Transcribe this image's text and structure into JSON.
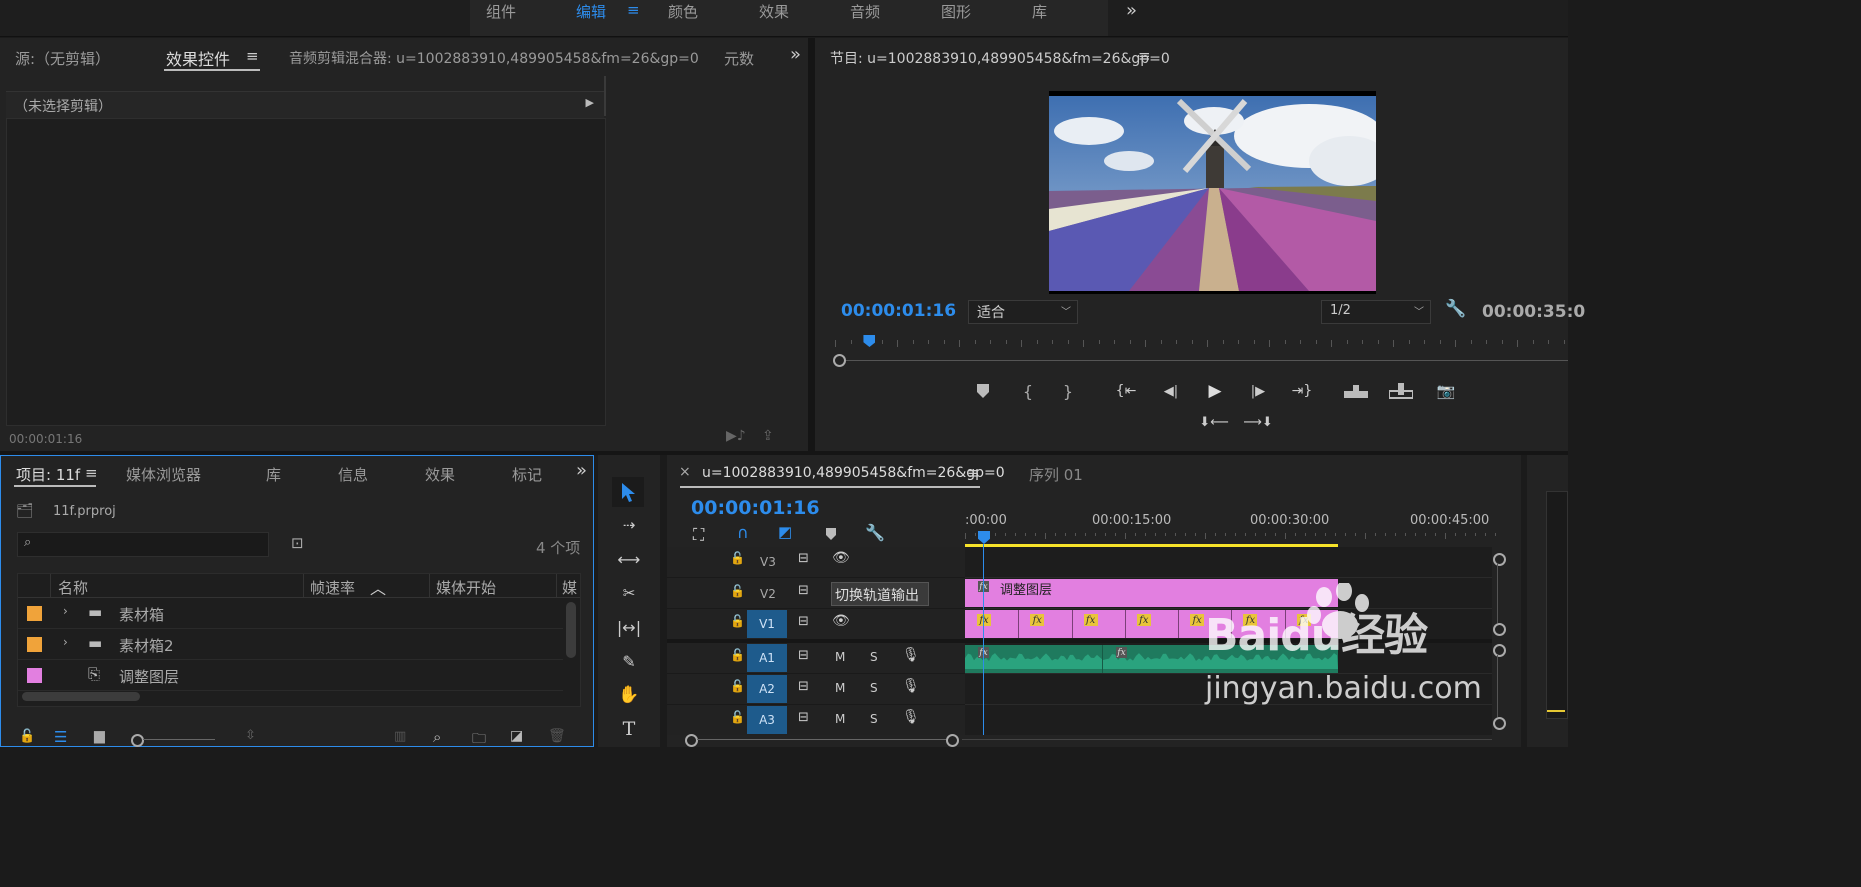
{
  "workspace_tabs": {
    "items": [
      "组件",
      "编辑",
      "颜色",
      "效果",
      "音频",
      "图形",
      "库"
    ],
    "active": "编辑",
    "more": "»"
  },
  "source_panel": {
    "tabs": [
      "源:（无剪辑）",
      "效果控件",
      "音频剪辑混合器: u=1002883910,489905458&fm=26&gp=0",
      "元数"
    ],
    "active_tab": "效果控件",
    "no_clip_label": "（未选择剪辑）",
    "timecode": "00:00:01:16",
    "more": "»"
  },
  "program_monitor": {
    "title": "节目: u=1002883910,489905458&fm=26&gp=0",
    "timecode": "00:00:01:16",
    "fit_label": "适合",
    "resolution": "1/2",
    "duration": "00:00:35:0",
    "playhead_fraction": 0.047
  },
  "project_panel": {
    "tabs": [
      "项目: 11f",
      "媒体浏览器",
      "库",
      "信息",
      "效果",
      "标记"
    ],
    "active_tab": "项目: 11f",
    "project_file": "11f.prproj",
    "search_placeholder": "",
    "item_count": "4 个项",
    "columns": [
      "名称",
      "帧速率",
      "媒体开始",
      "媒"
    ],
    "rows": [
      {
        "color": "#f0a33a",
        "expandable": true,
        "icon": "folder-icon",
        "name": "素材箱"
      },
      {
        "color": "#f0a33a",
        "expandable": true,
        "icon": "folder-icon",
        "name": "素材箱2"
      },
      {
        "color": "#e27fe0",
        "expandable": false,
        "icon": "adjustment-layer-icon",
        "name": "调整图层"
      }
    ]
  },
  "timeline": {
    "close": "×",
    "sequence_tab": "u=1002883910,489905458&fm=26&gp=0",
    "other_tab": "序列 01",
    "timecode": "00:00:01:16",
    "ruler_labels": [
      ":00:00",
      "00:00:15:00",
      "00:00:30:00",
      "00:00:45:00"
    ],
    "tracks": {
      "video": [
        "V3",
        "V2",
        "V1"
      ],
      "audio": [
        "A1",
        "A2",
        "A3"
      ],
      "audio_buttons": [
        "M",
        "S"
      ]
    },
    "tooltip": "切换轨道输出",
    "clip_v2_label": "调整图层",
    "fx_label": "fx",
    "fx_count": 7
  },
  "watermark": {
    "brand": "Baidu经验",
    "url": "jingyan.baidu.com"
  },
  "colors": {
    "accent": "#2d8ceb",
    "adjustment_clip": "#e27fe0",
    "audio_clip": "#2aa37e",
    "work_area": "#f7e32a",
    "track_target": "#1e5b8c"
  }
}
